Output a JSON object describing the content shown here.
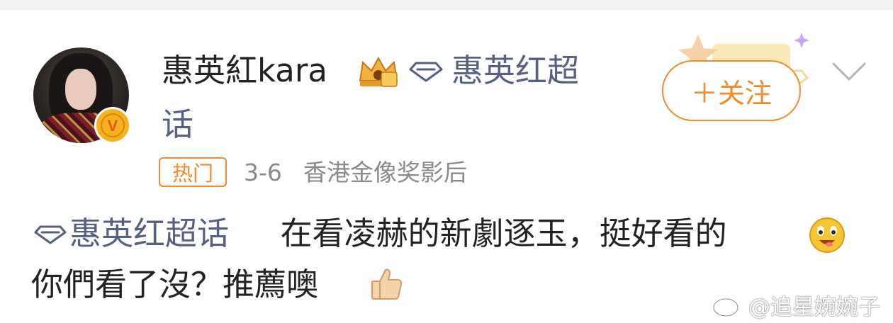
{
  "post": {
    "author": {
      "name": "惠英紅kara",
      "verified_badge": "V",
      "crown_icon": "crown-level-icon"
    },
    "header_topic": {
      "icon": "diamond-topic-icon",
      "line1": "惠英红超",
      "line2": "话"
    },
    "follow_button": {
      "label": "＋关注"
    },
    "meta": {
      "hot_badge": "热门",
      "date": "3-6",
      "source": "香港金像奖影后"
    },
    "body": {
      "topic_tag": "惠英红超话",
      "line1_text": "在看凌赫的新劇逐玉，挺好看的",
      "line2_text": "你們看了沒？推薦噢"
    },
    "watermark": "@追星婉婉子"
  },
  "colors": {
    "accent_orange": "#f28a2e",
    "topic_blue": "#56607f",
    "meta_gray": "#8a8a8a",
    "verified_gold": "#f6b21e"
  }
}
